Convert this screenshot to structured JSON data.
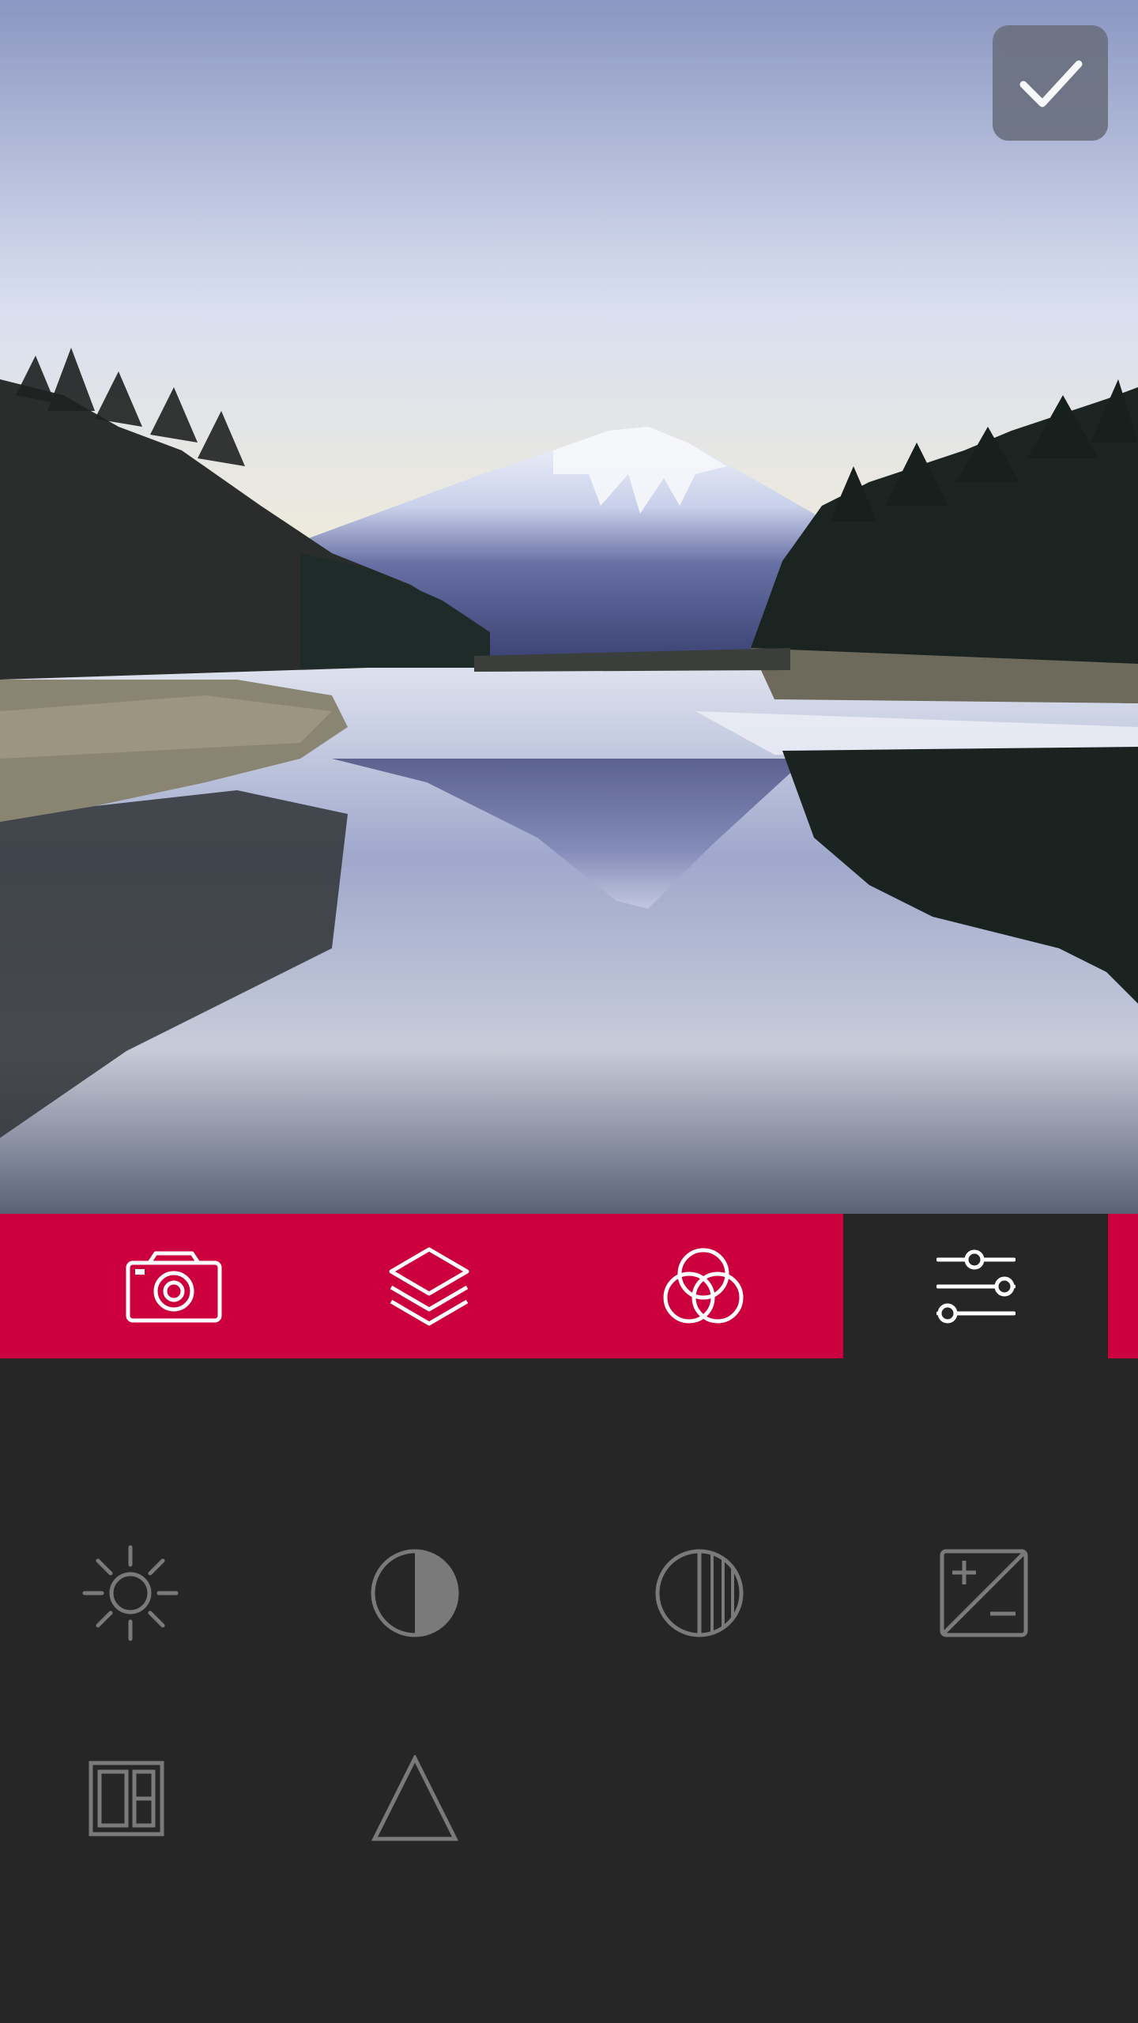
{
  "confirm": {
    "icon": "checkmark-icon"
  },
  "toolbar": {
    "accent_color": "#cc003c",
    "active_tab": "adjust",
    "tabs": [
      {
        "id": "camera",
        "icon": "camera-icon"
      },
      {
        "id": "layers",
        "icon": "layers-icon"
      },
      {
        "id": "filters",
        "icon": "filters-icon"
      },
      {
        "id": "adjust",
        "icon": "sliders-icon"
      }
    ]
  },
  "adjust_tools": [
    {
      "id": "brightness",
      "icon": "sun-icon"
    },
    {
      "id": "contrast",
      "icon": "half-circle-icon"
    },
    {
      "id": "saturation",
      "icon": "striped-circle-icon"
    },
    {
      "id": "exposure",
      "icon": "plus-minus-icon"
    },
    {
      "id": "vignette",
      "icon": "panels-icon"
    },
    {
      "id": "sharpen",
      "icon": "triangle-icon"
    }
  ],
  "photo": {
    "subject": "mountain-lake-landscape"
  }
}
